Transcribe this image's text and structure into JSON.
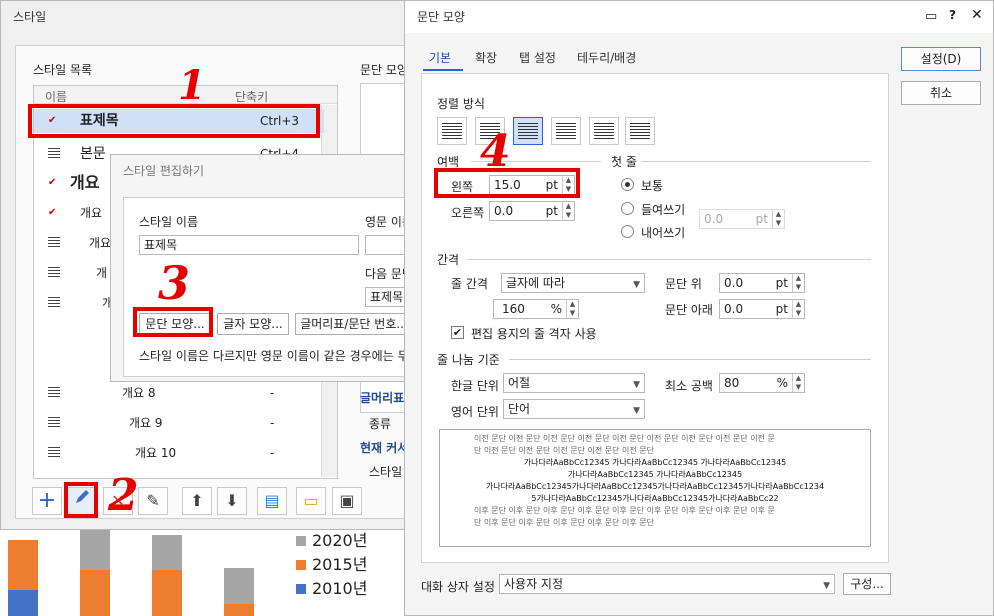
{
  "background": {
    "legend": [
      {
        "label": "2020년",
        "color": "#a6a6a6"
      },
      {
        "label": "2015년",
        "color": "#ed7d31"
      },
      {
        "label": "2010년",
        "color": "#4472c4"
      }
    ]
  },
  "style_dialog": {
    "title": "스타일",
    "list_label": "스타일 목록",
    "col_name": "이름",
    "col_shortcut": "단축키",
    "preview_label": "문단 모양",
    "items": [
      {
        "name": "표제목",
        "key": "Ctrl+3"
      },
      {
        "name": "본문",
        "key": "Ctrl+4"
      },
      {
        "name": "개요",
        "key": ""
      },
      {
        "name": "개요",
        "key": ""
      },
      {
        "name": "개요",
        "key": ""
      },
      {
        "name": "개",
        "key": ""
      },
      {
        "name": "개",
        "key": ""
      },
      {
        "name": "개요 8",
        "key": "-"
      },
      {
        "name": "개요 9",
        "key": "-"
      },
      {
        "name": "개요 10",
        "key": "-"
      }
    ],
    "side_labels": {
      "bullet": "글머리표",
      "kind": "종류",
      "current": "현재 커서",
      "style": "스타일"
    }
  },
  "edit_dialog": {
    "title": "스타일 편집하기",
    "name_label": "스타일 이름",
    "name_value": "표제목",
    "eng_label": "영문 이름",
    "next_label": "다음 문단",
    "next_value": "표제목",
    "btn_para": "문단 모양...",
    "btn_char": "글자 모양...",
    "btn_bullet": "글머리표/문단 번호...",
    "note": "스타일 이름은 다르지만 영문 이름이 같은 경우에는 두"
  },
  "para_dialog": {
    "title": "문단 모양",
    "tabs": [
      "기본",
      "확장",
      "탭 설정",
      "테두리/배경"
    ],
    "ok": "설정(D)",
    "cancel": "취소",
    "align_label": "정렬 방식",
    "margin_label": "여백",
    "left_label": "왼쪽",
    "left_value": "15.0",
    "right_label": "오른쪽",
    "right_value": "0.0",
    "unit": "pt",
    "first_label": "첫 줄",
    "first_opts": [
      "보통",
      "들여쓰기",
      "내어쓰기"
    ],
    "first_value": "0.0",
    "spacing_label": "간격",
    "line_label": "줄 간격",
    "line_mode": "글자에 따라",
    "line_value": "160",
    "pct": "%",
    "above_label": "문단 위",
    "above_value": "0.0",
    "below_label": "문단 아래",
    "below_value": "0.0",
    "grid_label": "편집 용지의 줄 격자 사용",
    "break_label": "줄 나눔 기준",
    "kor_label": "한글 단위",
    "kor_value": "어절",
    "eng_label": "영어 단위",
    "eng_value": "단어",
    "min_label": "최소 공백",
    "min_value": "80",
    "preview_lines": [
      "이전 문단 이전 문단 이전 문단 이전 문단 이전 문단 이전 문단 이전 문단 이전 문단 이전 문",
      "단 이전 문단 이전 문단 이전 문단 이전 문단 이전 문단",
      "가나다라AaBbCc12345 가나다라AaBbCc12345 가나다라AaBbCc12345",
      "가나다라AaBbCc12345 가나다라AaBbCc12345",
      "가나다라AaBbCc12345가나다라AaBbCc12345가나다라AaBbCc12345가나다라AaBbCc1234",
      "5가나다라AaBbCc12345가나다라AaBbCc12345가나다라AaBbCc22",
      "이후 문단 이후 문단 이후 문단 이후 문단 이후 문단 이후 문단 이후 문단 이후 문단 이후 문",
      "단 이후 문단 이후 문단 이후 문단 이후 문단 이후 문단"
    ],
    "dialog_setting_label": "대화 상자 설정",
    "dialog_setting_value": "사용자 지정",
    "config_btn": "구성..."
  },
  "annotations": {
    "n1": "1",
    "n2": "2",
    "n3": "3",
    "n4": "4"
  }
}
